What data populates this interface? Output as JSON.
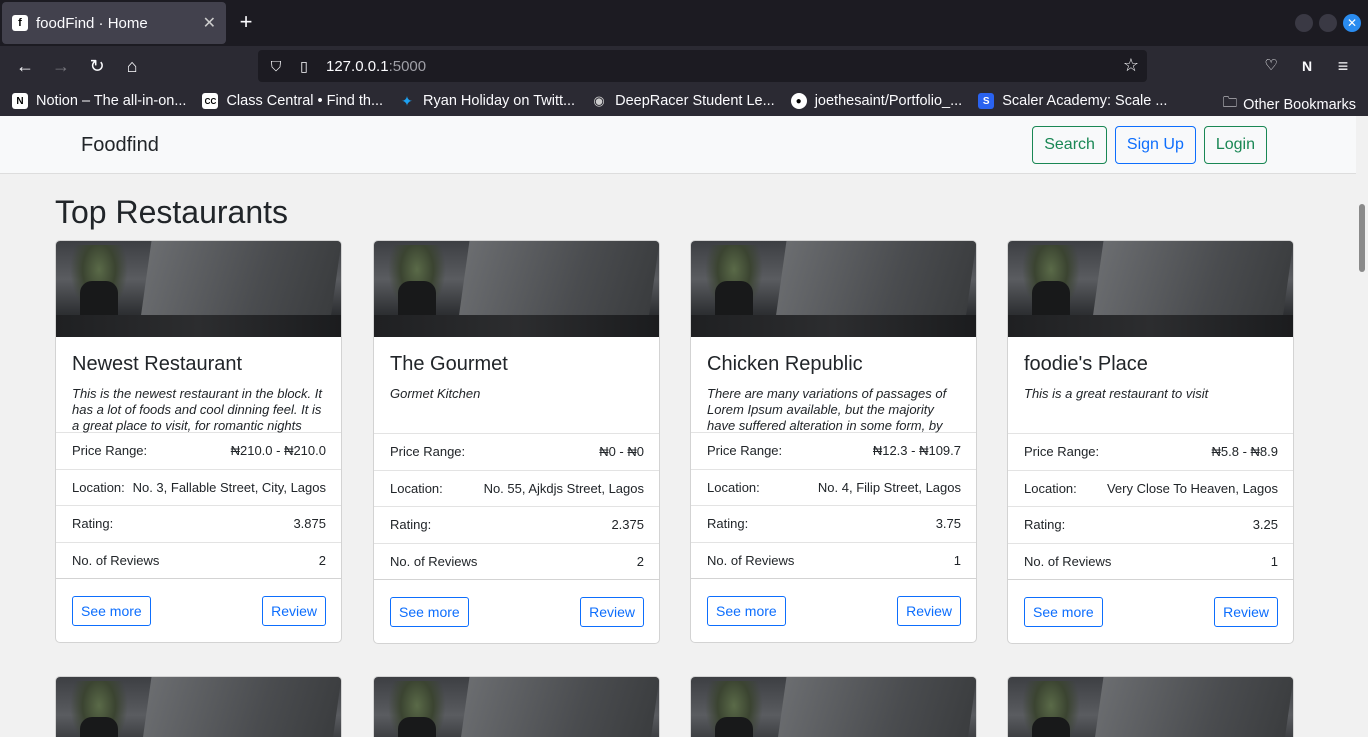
{
  "browser": {
    "tab_title": "foodFind · Home",
    "url_host": "127.0.0.1",
    "url_port": ":5000",
    "bookmarks": [
      {
        "label": "Notion – The all-in-on...",
        "icon": "notion-icon"
      },
      {
        "label": "Class Central • Find th...",
        "icon": "classcentral-icon"
      },
      {
        "label": "Ryan Holiday on Twitt...",
        "icon": "twitter-icon"
      },
      {
        "label": "DeepRacer Student Le...",
        "icon": "deepracer-icon"
      },
      {
        "label": "joethesaint/Portfolio_...",
        "icon": "github-icon"
      },
      {
        "label": "Scaler Academy: Scale ...",
        "icon": "scaler-icon"
      }
    ],
    "other_bookmarks": "Other Bookmarks"
  },
  "site": {
    "brand": "Foodfind",
    "nav": {
      "search": "Search",
      "signup": "Sign Up",
      "login": "Login"
    },
    "heading": "Top Restaurants"
  },
  "labels": {
    "price": "Price Range:",
    "location": "Location:",
    "rating": "Rating:",
    "reviews": "No. of Reviews",
    "see_more": "See more",
    "review": "Review"
  },
  "restaurants": [
    {
      "name": "Newest Restaurant",
      "description": "This is the newest restaurant in the block. It has a lot of foods and cool dinning feel. It is a great place to visit, for romantic nights",
      "price": "₦210.0 - ₦210.0",
      "location": "No. 3, Fallable Street, City, Lagos",
      "rating": "3.875",
      "reviews": "2"
    },
    {
      "name": "The Gourmet",
      "description": "Gormet Kitchen",
      "price": "₦0 - ₦0",
      "location": "No. 55, Ajkdjs Street, Lagos",
      "rating": "2.375",
      "reviews": "2"
    },
    {
      "name": "Chicken Republic",
      "description": "There are many variations of passages of Lorem Ipsum available, but the majority have suffered alteration in some form, by",
      "price": "₦12.3 - ₦109.7",
      "location": "No. 4, Filip Street, Lagos",
      "rating": "3.75",
      "reviews": "1"
    },
    {
      "name": "foodie's Place",
      "description": "This is a great restaurant to visit",
      "price": "₦5.8 - ₦8.9",
      "location": "Very Close To Heaven, Lagos",
      "rating": "3.25",
      "reviews": "1"
    }
  ]
}
